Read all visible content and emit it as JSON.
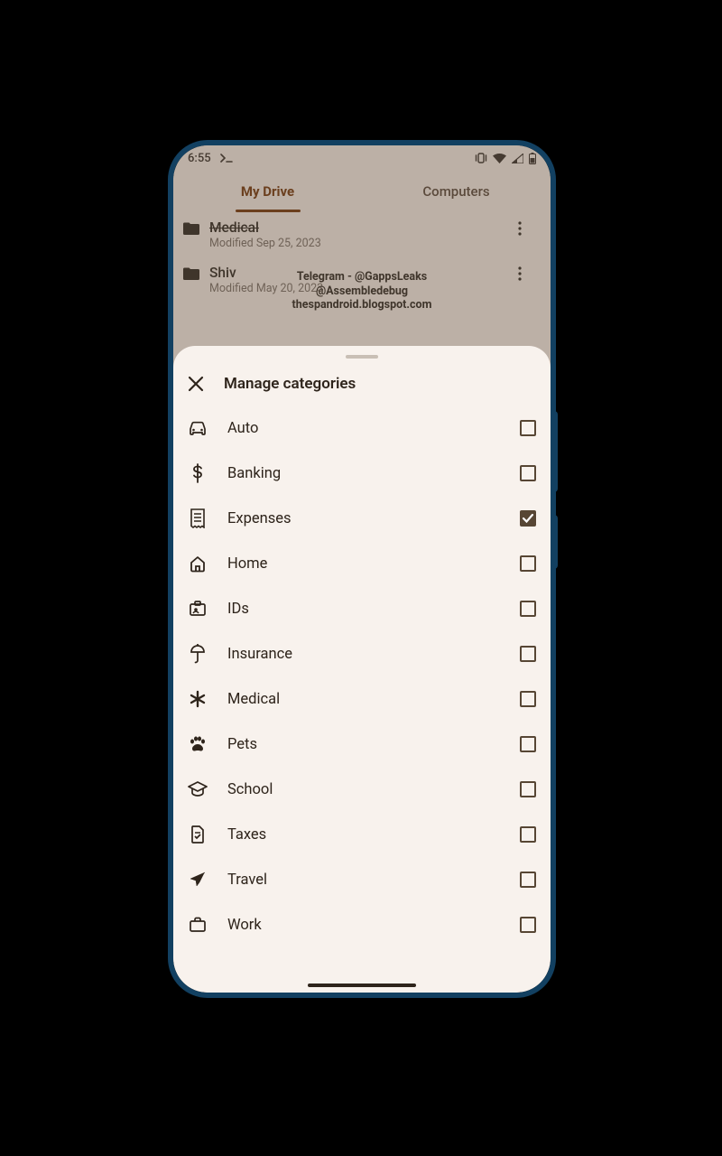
{
  "statusbar": {
    "time": "6:55"
  },
  "tabs": {
    "active": "My Drive",
    "other": "Computers"
  },
  "files": [
    {
      "name": "Medical",
      "sub": "Modified Sep 25, 2023"
    },
    {
      "name": "Shiv",
      "sub": "Modified May 20, 2023"
    }
  ],
  "watermark": {
    "line1": "Telegram - @GappsLeaks",
    "line2": "@Assembledebug",
    "line3": "thespandroid.blogspot.com"
  },
  "sheet": {
    "title": "Manage categories",
    "categories": [
      {
        "label": "Auto",
        "icon": "car",
        "checked": false
      },
      {
        "label": "Banking",
        "icon": "dollar",
        "checked": false
      },
      {
        "label": "Expenses",
        "icon": "receipt",
        "checked": true
      },
      {
        "label": "Home",
        "icon": "home",
        "checked": false
      },
      {
        "label": "IDs",
        "icon": "id",
        "checked": false
      },
      {
        "label": "Insurance",
        "icon": "umbrella",
        "checked": false
      },
      {
        "label": "Medical",
        "icon": "asterisk",
        "checked": false
      },
      {
        "label": "Pets",
        "icon": "paw",
        "checked": false
      },
      {
        "label": "School",
        "icon": "grad",
        "checked": false
      },
      {
        "label": "Taxes",
        "icon": "doc",
        "checked": false
      },
      {
        "label": "Travel",
        "icon": "plane",
        "checked": false
      },
      {
        "label": "Work",
        "icon": "brief",
        "checked": false
      }
    ]
  }
}
